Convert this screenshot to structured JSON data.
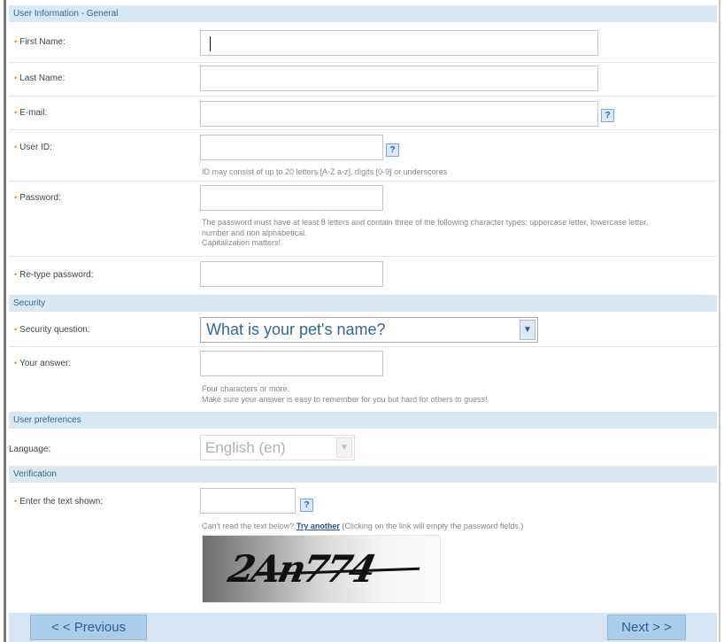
{
  "sections": {
    "general": "User Information - General",
    "security": "Security",
    "preferences": "User preferences",
    "verification": "Verification"
  },
  "fields": {
    "first_name": {
      "label": "First Name:",
      "value": ""
    },
    "last_name": {
      "label": "Last Name:",
      "value": ""
    },
    "email": {
      "label": "E-mail:",
      "value": ""
    },
    "user_id": {
      "label": "User ID:",
      "value": "",
      "hint": "ID may consist of up to 20 letters [A-Z a-z], digits [0-9] or underscores"
    },
    "password": {
      "label": "Password:",
      "value": "",
      "hint_lines": [
        "The password must have at least 8 letters and contain three of the following character types: uppercase letter, lowercase letter,",
        "number and non alphabetical.",
        "Capitalization matters!"
      ]
    },
    "retype_password": {
      "label": "Re-type password:",
      "value": ""
    },
    "security_question": {
      "label": "Security question:",
      "selected": "What is your pet's name?"
    },
    "answer": {
      "label": "Your answer:",
      "value": "",
      "hint_lines": [
        "Four characters or more.",
        "Make sure your answer is easy to remember for you but hard for others to guess!"
      ]
    },
    "language": {
      "label": "Language:",
      "selected": "English (en)"
    },
    "captcha": {
      "label": "Enter the text shown:",
      "value": "",
      "hint_prefix": "Can't read the text below?",
      "link": "Try another",
      "hint_suffix": "(Clicking on the link will empty the password fields.)",
      "image_text": "2An774"
    }
  },
  "help_icon": "?",
  "dropdown_icon": "chevron-down",
  "buttons": {
    "previous": "< < Previous",
    "next": "Next > >"
  },
  "colors": {
    "section_bg": "#d9e8f1",
    "section_text": "#2d6a96",
    "required_star": "#f08020",
    "button_bg": "#a9cdeb"
  }
}
